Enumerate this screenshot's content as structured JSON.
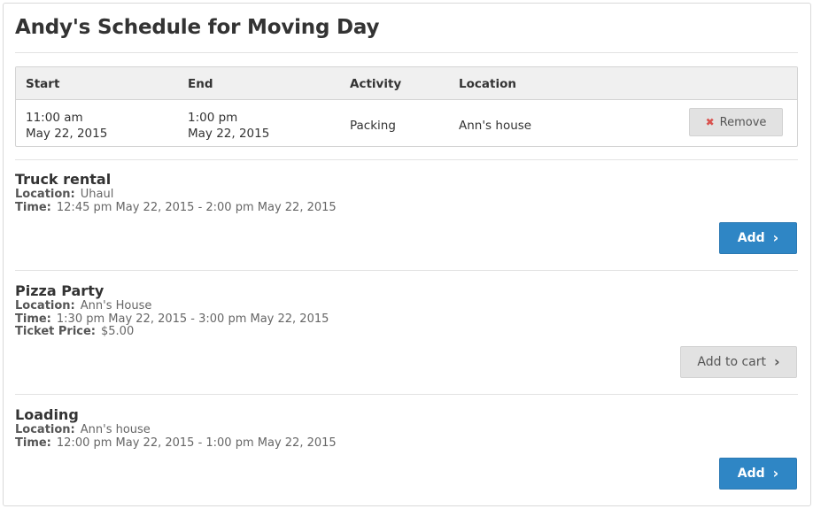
{
  "page": {
    "title": "Andy's Schedule for Moving Day"
  },
  "schedule": {
    "headers": {
      "start": "Start",
      "end": "End",
      "activity": "Activity",
      "location": "Location"
    },
    "rows": [
      {
        "start_time": "11:00 am",
        "start_date": "May 22, 2015",
        "end_time": "1:00 pm",
        "end_date": "May 22, 2015",
        "activity": "Packing",
        "location": "Ann's house",
        "remove_label": "Remove"
      }
    ]
  },
  "labels": {
    "location": "Location:",
    "time": "Time:",
    "ticket_price": "Ticket Price:"
  },
  "events": [
    {
      "title": "Truck rental",
      "location": "Uhaul",
      "time": "12:45 pm May 22, 2015 - 2:00 pm May 22, 2015",
      "button_label": "Add"
    },
    {
      "title": "Pizza Party",
      "location": "Ann's House",
      "time": "1:30 pm May 22, 2015 - 3:00 pm May 22, 2015",
      "ticket_price": "$5.00",
      "button_label": "Add to cart"
    },
    {
      "title": "Loading",
      "location": "Ann's house",
      "time": "12:00 pm May 22, 2015 - 1:00 pm May 22, 2015",
      "button_label": "Add"
    }
  ],
  "colors": {
    "primary": "#2f86c5",
    "danger": "#d9534f",
    "secondary": "#e2e2e2"
  }
}
